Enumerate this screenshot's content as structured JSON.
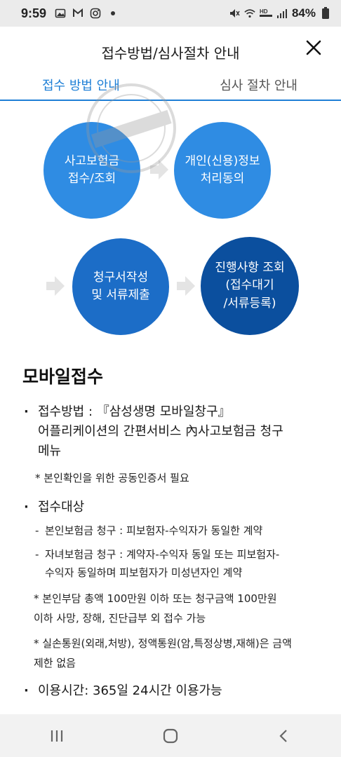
{
  "status_bar": {
    "time": "9:59",
    "battery": "84%",
    "left_icons": [
      "image-icon",
      "gmail-icon",
      "instagram-icon",
      "dot-icon"
    ],
    "right_icons": [
      "mute-icon",
      "wifi-icon",
      "hd-voice-icon",
      "signal-icon",
      "battery-icon"
    ]
  },
  "header": {
    "title": "접수방법/심사절차 안내"
  },
  "tabs": [
    {
      "label": "접수 방법 안내",
      "active": true
    },
    {
      "label": "심사 절차 안내",
      "active": false
    }
  ],
  "steps": [
    {
      "line1": "사고보험금",
      "line2": "접수/조회",
      "line3": ""
    },
    {
      "line1": "개인(신용)정보",
      "line2": "처리동의",
      "line3": ""
    },
    {
      "line1": "청구서작성",
      "line2": "및 서류제출",
      "line3": ""
    },
    {
      "line1": "진행사항 조회",
      "line2": "(접수대기",
      "line3": "/서류등록)"
    }
  ],
  "mobile": {
    "heading": "모바일접수",
    "method_label_1": "접수방법 : 『삼성생명 모바일창구』",
    "method_label_2": "어플리케이션의 간편서비스 內사고보험금 청구",
    "method_label_3": "메뉴",
    "method_note": "* 본인확인을 위한 공동인증서 필요",
    "target_label": "접수대상",
    "target_item_1": "본인보험금 청구 : 피보험자-수익자가 동일한 계약",
    "target_item_2a": "자녀보험금 청구 : 계약자-수익자 동일 또는 피보험자-",
    "target_item_2b": "수익자 동일하며 피보험자가 미성년자인 계약",
    "target_note_1a": "* 본인부담 총액 100만원 이하 또는 청구금액 100만원",
    "target_note_1b": "이하 사망, 장해, 진단급부 외 접수 가능",
    "target_note_2a": "* 실손통원(외래,처방), 정액통원(암,특정상병,재해)은 금액",
    "target_note_2b": "제한 없음",
    "hours": "이용시간: 365일 24시간 이용가능"
  },
  "colors": {
    "accent": "#1e7fd6",
    "step_light": "#2f8ce3",
    "step_mid": "#1c6dc7",
    "step_dark": "#0b4f9e"
  }
}
